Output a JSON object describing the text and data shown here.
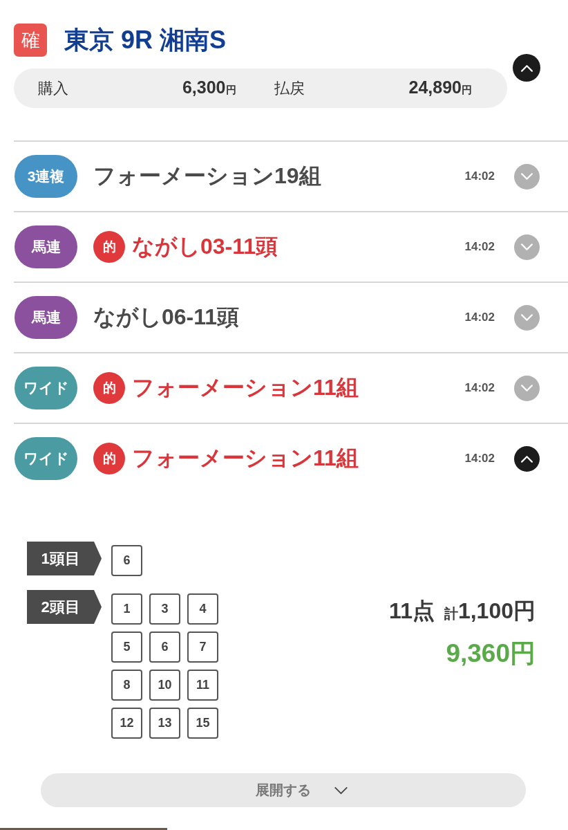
{
  "race": {
    "status_badge": "確",
    "title": "東京 9R 湘南S",
    "expanded": true
  },
  "summary": {
    "purchase_label": "購入",
    "purchase_amount": "6,300",
    "purchase_unit": "円",
    "payout_label": "払戻",
    "payout_amount": "24,890",
    "payout_unit": "円"
  },
  "bets": [
    {
      "type": "3連複",
      "color": "#4694c6",
      "hit": false,
      "description": "フォーメーション19組",
      "time": "14:02",
      "expanded": false
    },
    {
      "type": "馬連",
      "color": "#8b519f",
      "hit": true,
      "hit_mark": "的",
      "description": "ながし03-11頭",
      "time": "14:02",
      "expanded": false
    },
    {
      "type": "馬連",
      "color": "#8b519f",
      "hit": false,
      "description": "ながし06-11頭",
      "time": "14:02",
      "expanded": false
    },
    {
      "type": "ワイド",
      "color": "#4b9ca2",
      "hit": true,
      "hit_mark": "的",
      "description": "フォーメーション11組",
      "time": "14:02",
      "expanded": false
    },
    {
      "type": "ワイド",
      "color": "#4b9ca2",
      "hit": true,
      "hit_mark": "的",
      "description": "フォーメーション11組",
      "time": "14:02",
      "expanded": true,
      "detail": {
        "positions": [
          {
            "label": "1頭目",
            "horses": [
              "6"
            ]
          },
          {
            "label": "2頭目",
            "horses": [
              "1",
              "3",
              "4",
              "5",
              "6",
              "7",
              "8",
              "10",
              "11",
              "12",
              "13",
              "15"
            ]
          }
        ],
        "points": "11点",
        "total_label": "計",
        "total_amount": "1,100円",
        "payout": "9,360円"
      }
    }
  ],
  "expand_button": {
    "label": "展開する"
  }
}
